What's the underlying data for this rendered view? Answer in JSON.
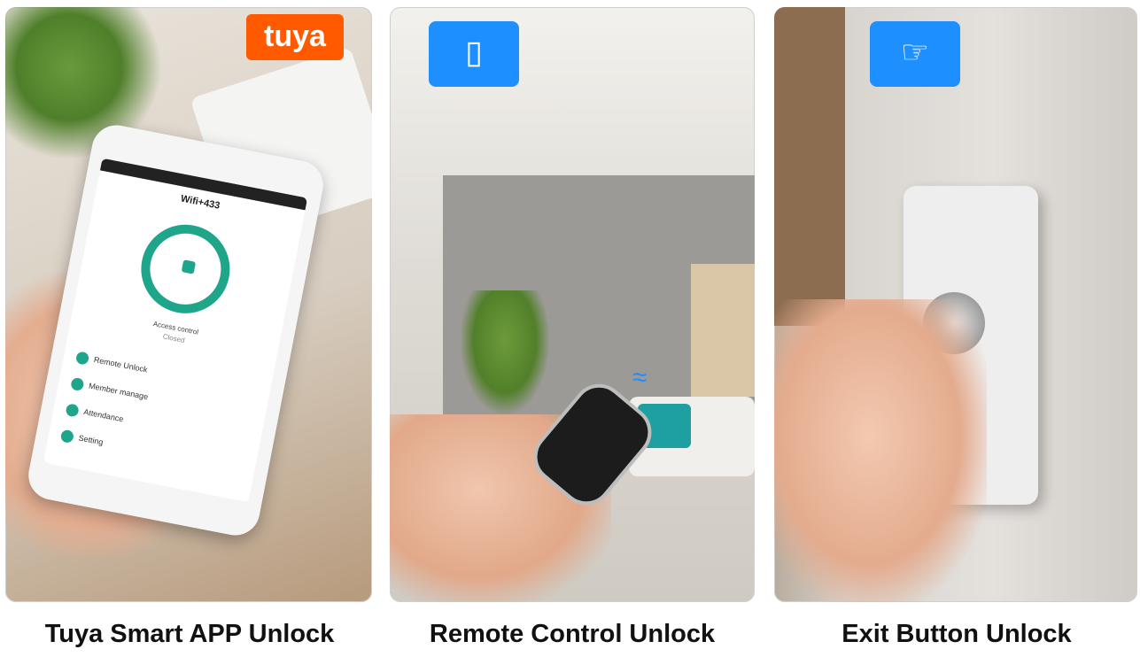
{
  "panels": [
    {
      "caption": "Tuya Smart APP Unlock",
      "brand_badge": "tuya",
      "app_screen": {
        "title": "Wifi+433",
        "lock_label": "Access control",
        "lock_status": "Closed",
        "rows": [
          "Remote Unlock",
          "Member manage",
          "Attendance",
          "Setting"
        ]
      }
    },
    {
      "caption": "Remote Control Unlock",
      "icon": "remote-control-icon"
    },
    {
      "caption": "Exit Button  Unlock",
      "icon": "press-button-icon"
    }
  ],
  "colors": {
    "accent_blue": "#1e8fff",
    "tuya_orange": "#ff5a00",
    "app_green": "#1fa58a"
  }
}
